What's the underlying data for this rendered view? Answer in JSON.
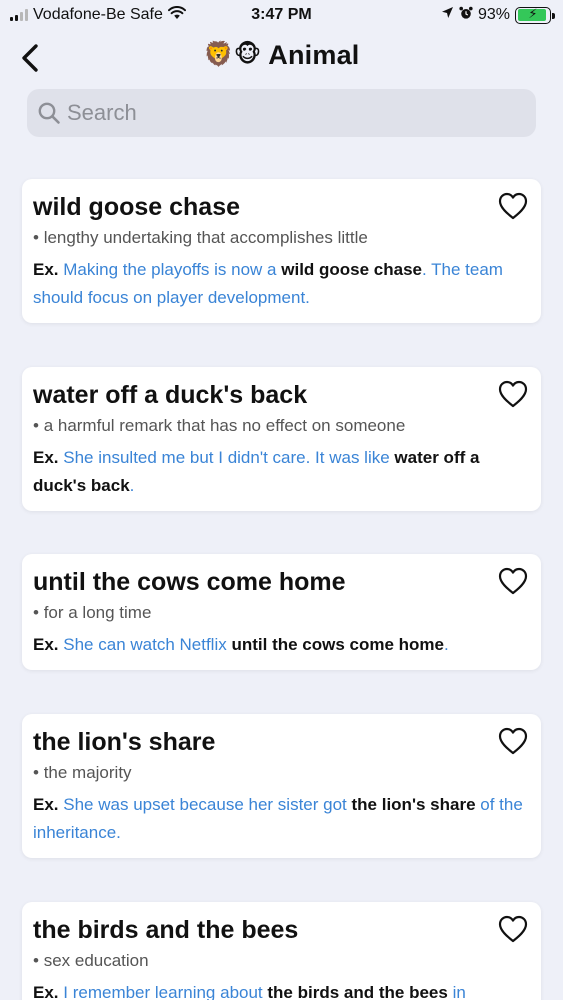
{
  "status_bar": {
    "carrier": "Vodafone-Be Safe",
    "time": "3:47 PM",
    "battery": "93%",
    "battery_level": 0.93,
    "wifi_icon": "wifi-icon",
    "location_icon": "location-arrow-icon",
    "alarm_icon": "alarm-icon"
  },
  "header": {
    "emoji": "🦁🐵",
    "title": "Animal",
    "back_icon": "chevron-left-icon"
  },
  "search": {
    "placeholder": "Search",
    "value": ""
  },
  "colors": {
    "example_text": "#3a84d6",
    "background": "#eef0f8",
    "card": "#ffffff"
  },
  "cards": [
    {
      "title": "wild goose chase",
      "meaning": "lengthy undertaking that accomplishes little",
      "example_label": "Ex.",
      "example_before": "Making the playoffs is now a",
      "example_idiom": "wild goose chase",
      "example_after": ". The team should focus on player development."
    },
    {
      "title": "water off a duck's back",
      "meaning": "a harmful remark that has no effect on someone",
      "example_label": "Ex.",
      "example_before": "She insulted me but I didn't care. It was like",
      "example_idiom": "water off a duck's back",
      "example_after": "."
    },
    {
      "title": "until the cows come home",
      "meaning": "for a long time",
      "example_label": "Ex.",
      "example_before": "She can watch Netflix",
      "example_idiom": "until the cows come home",
      "example_after": "."
    },
    {
      "title": "the lion's share",
      "meaning": "the majority",
      "example_label": "Ex.",
      "example_before": "She was upset because her sister got",
      "example_idiom": "the lion's share",
      "example_after": "of the inheritance."
    },
    {
      "title": "the birds and the bees",
      "meaning": "sex education",
      "example_label": "Ex.",
      "example_before": "I remember learning about",
      "example_idiom": "the birds and the bees",
      "example_after": "in"
    }
  ]
}
